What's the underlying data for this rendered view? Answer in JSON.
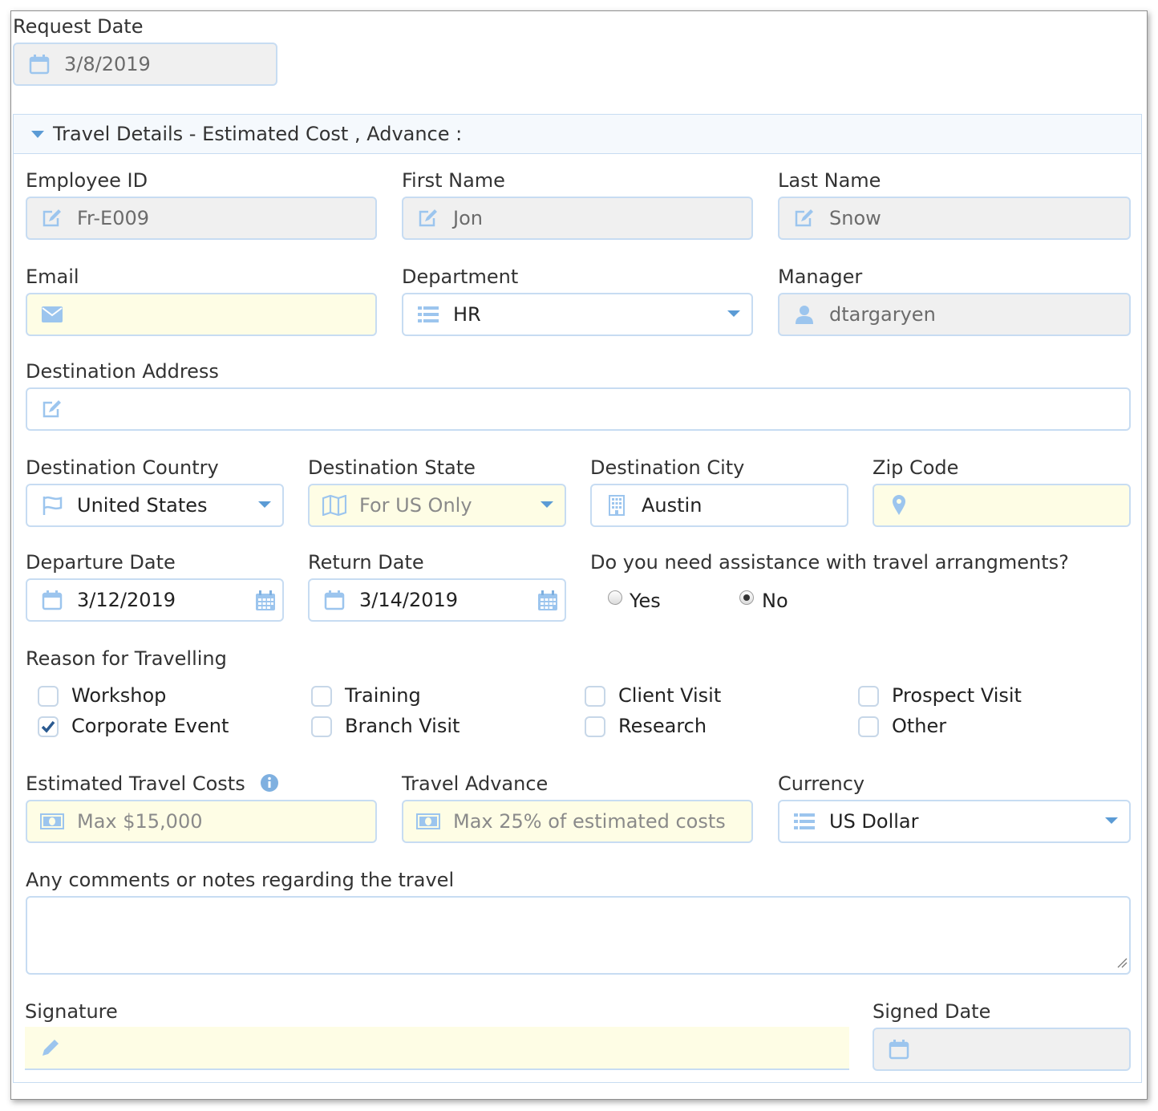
{
  "request_date": {
    "label": "Request Date",
    "value": "3/8/2019"
  },
  "panel": {
    "title": "Travel Details - Estimated Cost , Advance :"
  },
  "employee_id": {
    "label": "Employee ID",
    "value": "Fr-E009"
  },
  "first_name": {
    "label": "First Name",
    "value": "Jon"
  },
  "last_name": {
    "label": "Last Name",
    "value": "Snow"
  },
  "email": {
    "label": "Email",
    "value": ""
  },
  "department": {
    "label": "Department",
    "value": "HR"
  },
  "manager": {
    "label": "Manager",
    "value": "dtargaryen"
  },
  "destination_address": {
    "label": "Destination Address",
    "value": ""
  },
  "destination_country": {
    "label": "Destination Country",
    "value": "United States"
  },
  "destination_state": {
    "label": "Destination State",
    "placeholder": "For US Only"
  },
  "destination_city": {
    "label": "Destination City",
    "value": "Austin"
  },
  "zip_code": {
    "label": "Zip Code",
    "value": ""
  },
  "departure_date": {
    "label": "Departure Date",
    "value": "3/12/2019"
  },
  "return_date": {
    "label": "Return Date",
    "value": "3/14/2019"
  },
  "assistance": {
    "label": "Do you need assistance with travel arrangments?",
    "yes": "Yes",
    "no": "No",
    "selected": "No"
  },
  "reasons": {
    "label": "Reason for Travelling",
    "items": [
      {
        "label": "Workshop",
        "checked": false
      },
      {
        "label": "Training",
        "checked": false
      },
      {
        "label": "Client Visit",
        "checked": false
      },
      {
        "label": "Prospect Visit",
        "checked": false
      },
      {
        "label": "Corporate Event",
        "checked": true
      },
      {
        "label": "Branch Visit",
        "checked": false
      },
      {
        "label": "Research",
        "checked": false
      },
      {
        "label": "Other",
        "checked": false
      }
    ]
  },
  "estimated_costs": {
    "label": "Estimated Travel Costs",
    "placeholder": "Max $15,000"
  },
  "travel_advance": {
    "label": "Travel Advance",
    "placeholder": "Max 25% of estimated costs"
  },
  "currency": {
    "label": "Currency",
    "value": "US Dollar"
  },
  "comments": {
    "label": "Any comments or notes regarding the travel",
    "value": ""
  },
  "signature": {
    "label": "Signature"
  },
  "signed_date": {
    "label": "Signed Date",
    "value": ""
  },
  "colors": {
    "accent": "#5b9bd5",
    "icon": "#9cc5ee",
    "border": "#c7dcf2",
    "required_bg": "#fefde5",
    "readonly_bg": "#f0f0f0"
  }
}
